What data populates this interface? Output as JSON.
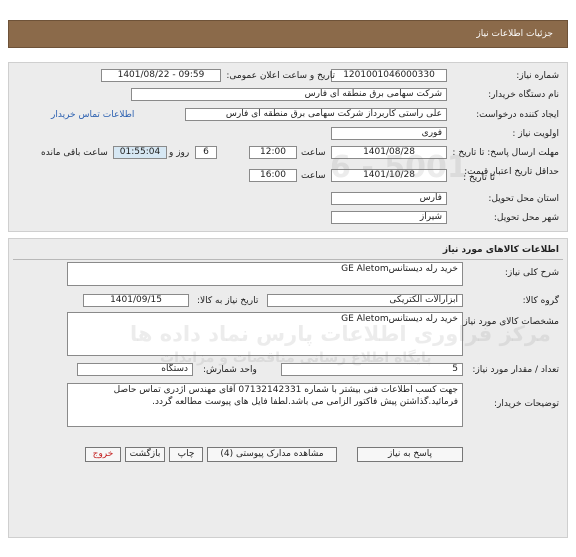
{
  "header": {
    "title": "جزئیات اطلاعات نیاز"
  },
  "info": {
    "need_number_label": "شماره نیاز:",
    "need_number": "1201001046000330",
    "announce_label": "تاریخ و ساعت اعلان عمومی:",
    "announce_value": "1401/08/22 - 09:59",
    "buyer_org_label": "نام دستگاه خریدار:",
    "buyer_org": "شرکت سهامی برق منطقه ای فارس",
    "requester_label": "ایجاد کننده درخواست:",
    "requester": "علی راستی کاربرداز شرکت سهامی برق منطقه ای فارس",
    "contact_link": "اطلاعات تماس خریدار",
    "priority_label": "اولویت نیاز :",
    "priority": "فوری",
    "deadline_label": "مهلت ارسال پاسخ: تا تاریخ :",
    "deadline_date": "1401/08/28",
    "time_label": "ساعت",
    "deadline_time": "12:00",
    "days_value": "6",
    "days_label": "روز و",
    "remaining_time": "01:55:04",
    "remaining_label": "ساعت باقی مانده",
    "validity_label": "حداقل تاریخ اعتبار قیمت:",
    "validity_to_label": "تا تاریخ :",
    "validity_date": "1401/10/28",
    "validity_time_label": "ساعت",
    "validity_time": "16:00",
    "province_label": "استان محل تحویل:",
    "province": "فارس",
    "city_label": "شهر محل تحویل:",
    "city": "شیراز"
  },
  "goods": {
    "section_title": "اطلاعات کالاهای مورد نیاز",
    "summary_label": "شرح کلی نیاز:",
    "summary": "خرید رله دیستانسGE Aletom",
    "group_label": "گروه کالا:",
    "group": "ابزارآلات الکتریکی",
    "need_date_label": "تاریخ نیاز به کالا:",
    "need_date": "1401/09/15",
    "specs_label": "مشخصات کالای مورد نیاز:",
    "specs": "خرید رله دیستانسGE Aletom",
    "qty_label": "تعداد / مقدار مورد نیاز:",
    "qty": "5",
    "unit_label": "واحد شمارش:",
    "unit": "دستگاه",
    "notes_label": "توضیحات خریدار:",
    "notes": "جهت کسب اطلاعات فنی بیشتر با شماره 07132142331 آقای مهندس اژدری تماس حاصل فرمائید.گذاشتن پیش فاکتور الزامی می باشد.لطفا فایل های پیوست مطالعه گردد."
  },
  "buttons": {
    "reply": "پاسخ به نیاز",
    "attachments": "مشاهده مدارک پیوستی (4)",
    "print": "چاپ",
    "back": "بازگشت",
    "exit": "خروج"
  },
  "watermark": {
    "line1": "مرکز فراوری اطلاعات پارس نماد داده ها",
    "line2": "پایگاه اطلاع رسانی مناقصات و مزایدات",
    "number": "5001 - 6"
  }
}
